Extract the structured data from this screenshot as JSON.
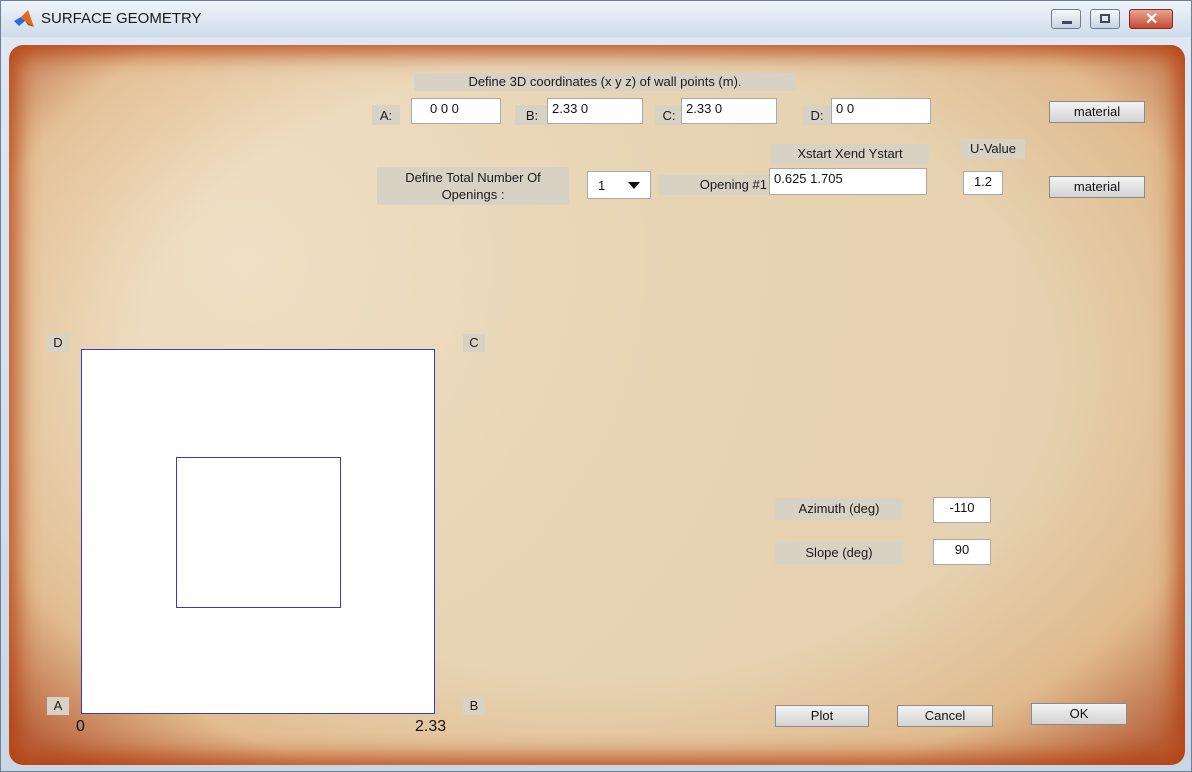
{
  "window": {
    "title": "SURFACE GEOMETRY"
  },
  "header": {
    "instruction": "Define 3D coordinates (x y z) of wall points (m)."
  },
  "points": [
    {
      "label": "A:",
      "value": "0  0  0"
    },
    {
      "label": "B:",
      "value": "2.33         0"
    },
    {
      "label": "C:",
      "value": "2.33         0"
    },
    {
      "label": "D:",
      "value": "0            0"
    }
  ],
  "material_label": "material",
  "openings": {
    "define_label": "Define Total Number Of Openings :",
    "count_selected": "1",
    "columns_label": "Xstart  Xend Ystart",
    "uvalue_label": "U-Value",
    "opening_label": "Opening #1",
    "opening_values": "0.625        1.705",
    "uvalue": "1.2"
  },
  "plot": {
    "corner_labels": {
      "D": "D",
      "C": "C",
      "A": "A",
      "B": "B"
    },
    "x_ticks": [
      "0",
      "2.33"
    ]
  },
  "orientation": {
    "azimuth_label": "Azimuth (deg)",
    "azimuth_value": "-110",
    "slope_label": "Slope (deg)",
    "slope_value": "90"
  },
  "buttons": {
    "plot": "Plot",
    "cancel": "Cancel",
    "ok": "OK"
  },
  "colors": {
    "plot_line": "#3a3abd",
    "frame_orange": "#c85a1e"
  }
}
